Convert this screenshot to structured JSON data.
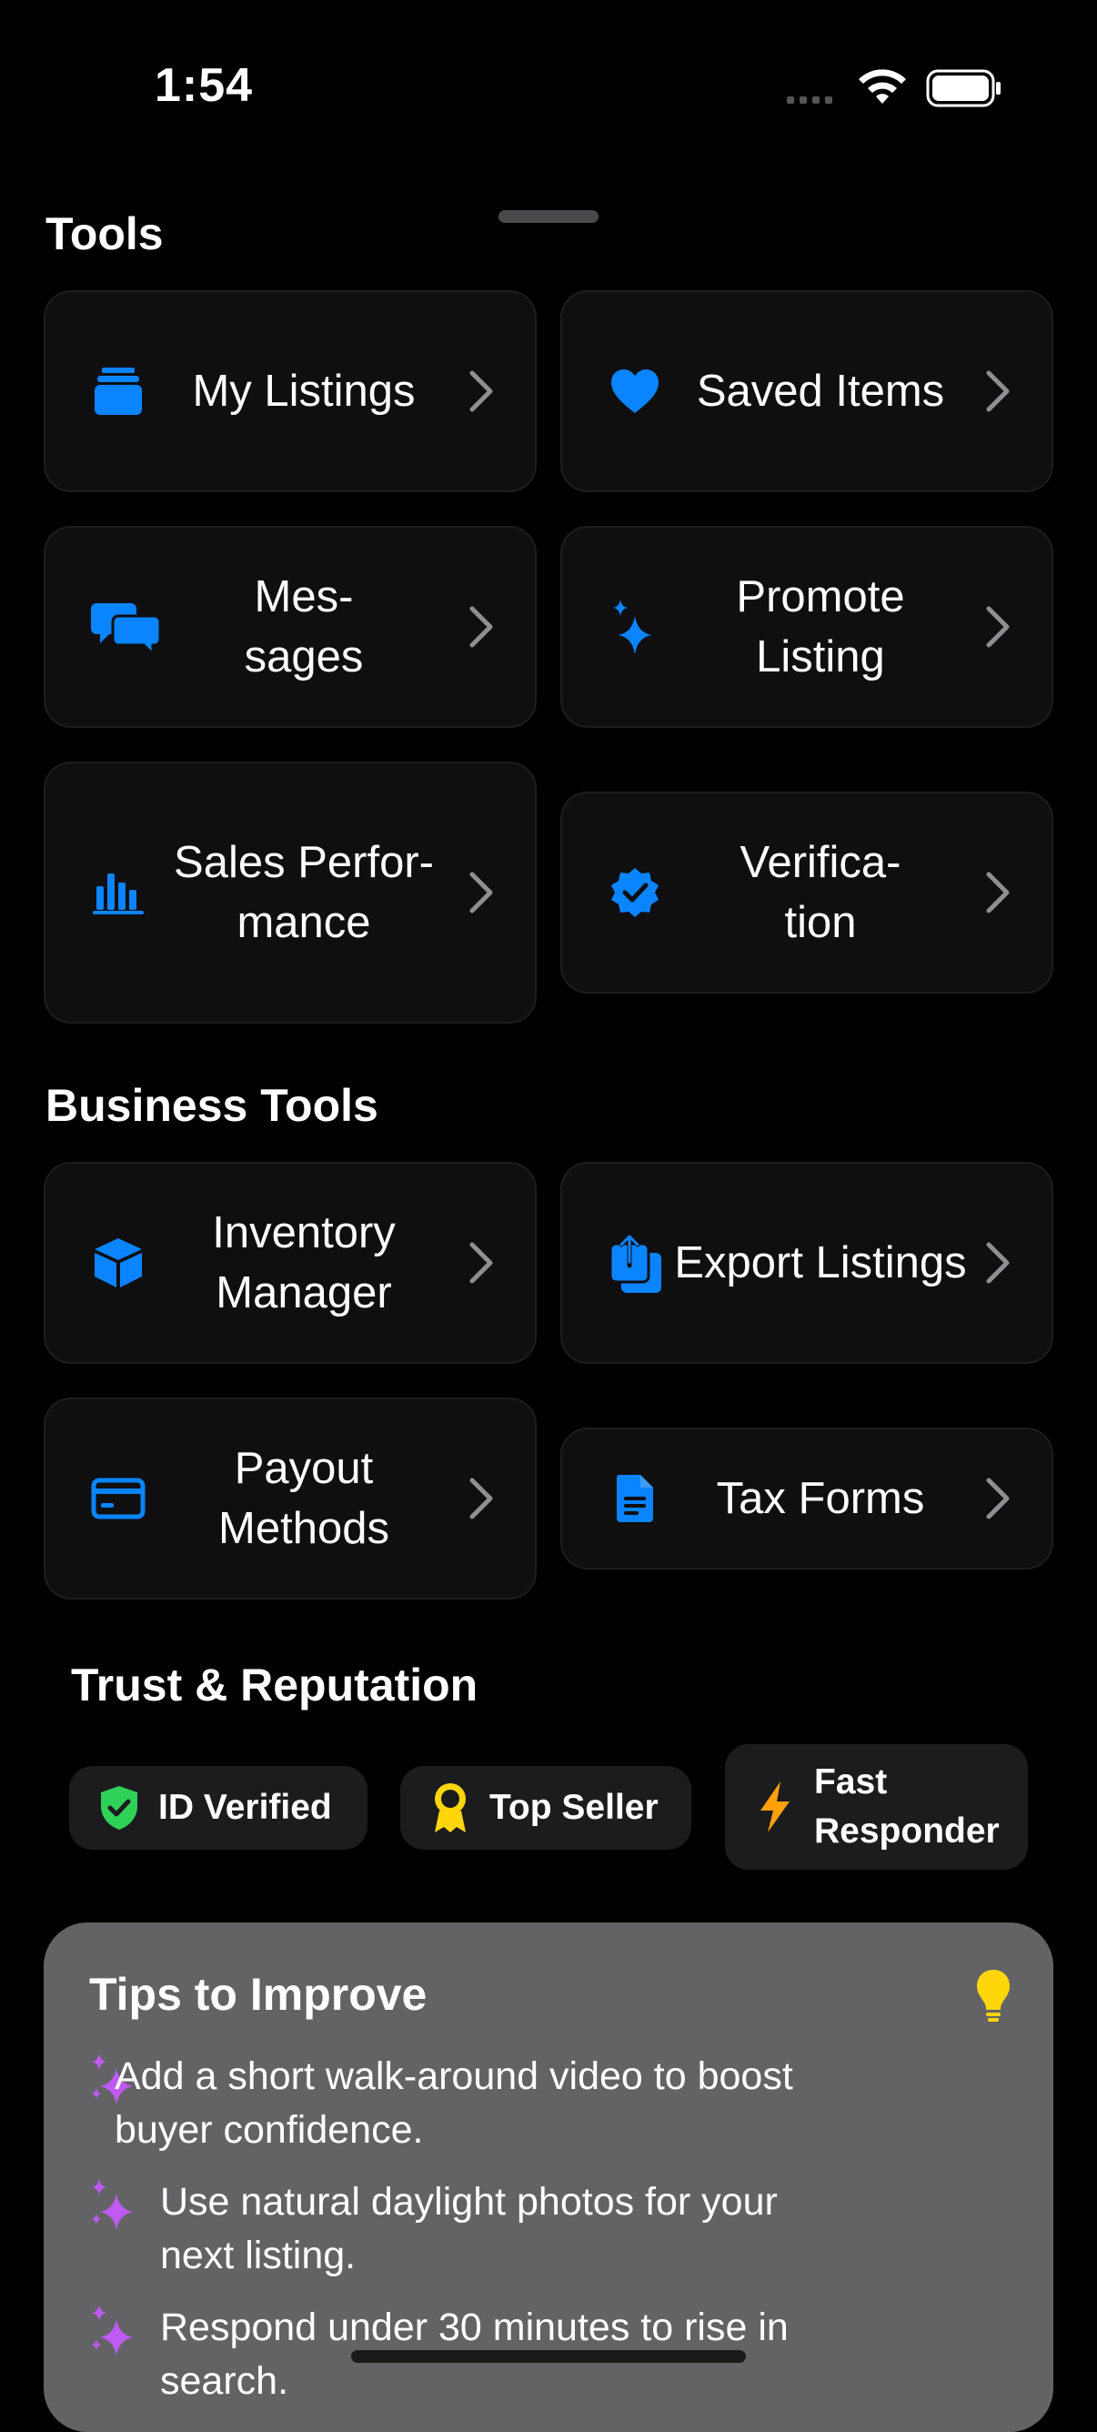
{
  "status_bar": {
    "time": "1:54"
  },
  "tools": {
    "title": "Tools",
    "items": [
      {
        "label": "My Listings",
        "icon": "stack-icon"
      },
      {
        "label": "Saved Items",
        "icon": "heart-icon"
      },
      {
        "label": "Mes-\nsages",
        "icon": "chat-bubbles-icon"
      },
      {
        "label": "Promote Listing",
        "icon": "sparkles-icon"
      },
      {
        "label": "Sales Perfor-\nmance",
        "icon": "bar-chart-icon"
      },
      {
        "label": "Verifica-\ntion",
        "icon": "checkmark-seal-icon"
      }
    ]
  },
  "business_tools": {
    "title": "Business Tools",
    "items": [
      {
        "label": "Inventory Manager",
        "icon": "box-icon"
      },
      {
        "label": "Export Listings",
        "icon": "export-icon"
      },
      {
        "label": "Payout Methods",
        "icon": "credit-card-icon"
      },
      {
        "label": "Tax Forms",
        "icon": "document-icon"
      }
    ]
  },
  "trust": {
    "title": "Trust & Reputation",
    "badges": [
      {
        "label": "ID Verified",
        "icon": "shield-check-icon"
      },
      {
        "label": "Top Seller",
        "icon": "rosette-icon"
      },
      {
        "label": "Fast Responder",
        "icon": "bolt-icon"
      }
    ]
  },
  "tips": {
    "title": "Tips to Improve",
    "items": [
      "Add a short walk-around video to boost buyer confidence.",
      "Use natural daylight photos for your next listing.",
      "Respond under 30 minutes to rise in search."
    ]
  },
  "colors": {
    "accent": "#0a84ff",
    "green": "#30d158",
    "yellow": "#ffd60a",
    "orange": "#ff9f0a",
    "purple": "#bf5af2",
    "tips_bg": "#636366"
  }
}
